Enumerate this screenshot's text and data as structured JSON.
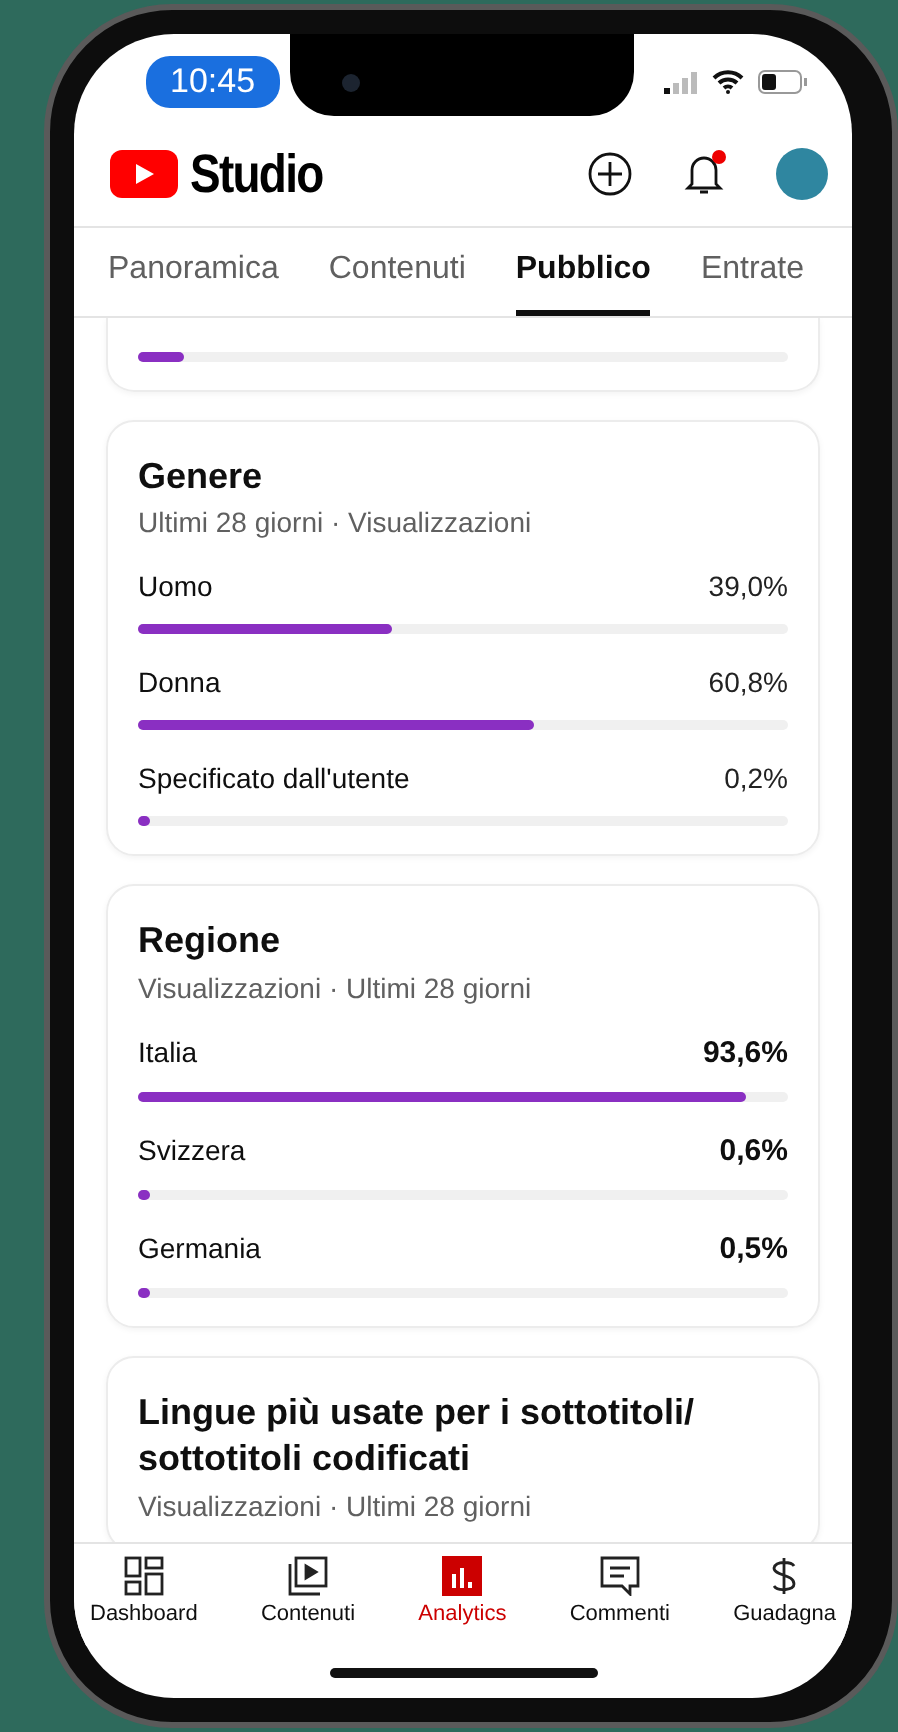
{
  "status_bar": {
    "time": "10:45"
  },
  "header": {
    "logo_text": "Studio",
    "notification_badge": true
  },
  "tabs": [
    {
      "label": "Panoramica",
      "selected": false
    },
    {
      "label": "Contenuti",
      "selected": false
    },
    {
      "label": "Pubblico",
      "selected": true
    },
    {
      "label": "Entrate",
      "selected": false
    }
  ],
  "partial_card": {
    "level": 0.07
  },
  "sections": [
    {
      "title": "Genere",
      "subtitle": "Ultimi 28 giorni · Visualizzazioni",
      "bold_values": false,
      "rows": [
        {
          "label": "Uomo",
          "value": "39,0%",
          "level": 0.39
        },
        {
          "label": "Donna",
          "value": "60,8%",
          "level": 0.608
        },
        {
          "label": "Specificato dall'utente",
          "value": "0,2%",
          "level": 0.002
        }
      ]
    },
    {
      "title": "Regione",
      "subtitle": "Visualizzazioni · Ultimi 28 giorni",
      "bold_values": true,
      "rows": [
        {
          "label": "Italia",
          "value": "93,6%",
          "level": 0.936
        },
        {
          "label": "Svizzera",
          "value": "0,6%",
          "level": 0.006
        },
        {
          "label": "Germania",
          "value": "0,5%",
          "level": 0.005
        }
      ]
    },
    {
      "title": "Lingue più usate per i sottotitoli/ sottotitoli codificati",
      "subtitle": "Visualizzazioni · Ultimi 28 giorni"
    }
  ],
  "bottom_nav": [
    {
      "kind": "dashboard",
      "label": "Dashboard",
      "selected": false
    },
    {
      "kind": "content",
      "label": "Contenuti",
      "selected": false
    },
    {
      "kind": "analytics",
      "label": "Analytics",
      "selected": true
    },
    {
      "kind": "comments",
      "label": "Commenti",
      "selected": false
    },
    {
      "kind": "earn",
      "label": "Guadagna",
      "selected": false
    }
  ]
}
